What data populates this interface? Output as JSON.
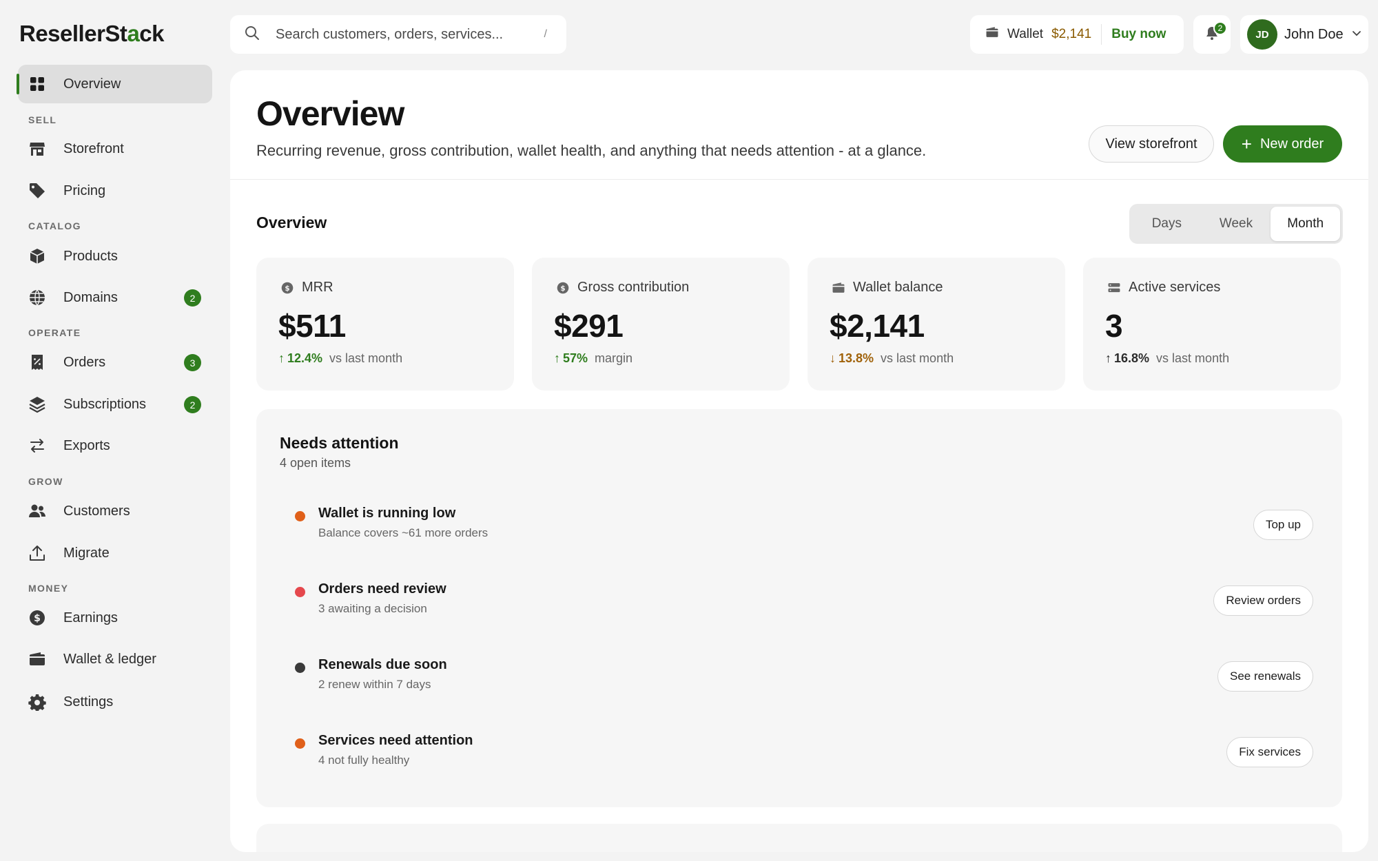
{
  "app": {
    "logo_text_1": "ResellerSt",
    "logo_text_2": "a",
    "logo_text_3": "ck"
  },
  "search": {
    "placeholder": "Search customers, orders, services...",
    "shortcut": "/"
  },
  "wallet": {
    "label": "Wallet",
    "amount": "$2,141",
    "buy_label": "Buy now"
  },
  "notifications": {
    "count": "2"
  },
  "user": {
    "initials": "JD",
    "name": "John Doe"
  },
  "sidebar": {
    "overview": "Overview",
    "sections": {
      "sell": "SELL",
      "catalog": "CATALOG",
      "operate": "OPERATE",
      "grow": "GROW",
      "money": "MONEY"
    },
    "items": {
      "storefront": "Storefront",
      "pricing": "Pricing",
      "products": "Products",
      "domains": "Domains",
      "domains_badge": "2",
      "orders": "Orders",
      "orders_badge": "3",
      "subscriptions": "Subscriptions",
      "subscriptions_badge": "2",
      "exports": "Exports",
      "customers": "Customers",
      "migrate": "Migrate",
      "earnings": "Earnings",
      "wallet_ledger": "Wallet & ledger",
      "settings": "Settings"
    }
  },
  "page": {
    "title": "Overview",
    "subtitle": "Recurring revenue, gross contribution, wallet health, and anything that needs attention - at a glance.",
    "view_storefront": "View storefront",
    "new_order": "New order"
  },
  "overview": {
    "title": "Overview",
    "periods": [
      "Days",
      "Week",
      "Month"
    ],
    "selected_period": "Month"
  },
  "kpis": [
    {
      "label": "MRR",
      "value": "$511",
      "delta": "12.4%",
      "direction": "up",
      "note": "vs last month"
    },
    {
      "label": "Gross contribution",
      "value": "$291",
      "delta": "57%",
      "direction": "up",
      "note": "margin"
    },
    {
      "label": "Wallet balance",
      "value": "$2,141",
      "delta": "13.8%",
      "direction": "down",
      "note": "vs last month"
    },
    {
      "label": "Active services",
      "value": "3",
      "delta": "16.8%",
      "direction": "up",
      "note": "vs last month"
    }
  ],
  "attention": {
    "title": "Needs attention",
    "subtitle": "4 open items",
    "items": [
      {
        "title": "Wallet is running low",
        "desc": "Balance covers ~61 more orders",
        "action": "Top up",
        "color": "#e0601a"
      },
      {
        "title": "Orders need review",
        "desc": "3 awaiting a decision",
        "action": "Review orders",
        "color": "#e5484d"
      },
      {
        "title": "Renewals due soon",
        "desc": "2 renew within 7 days",
        "action": "See renewals",
        "color": "#3a3a3a"
      },
      {
        "title": "Services need attention",
        "desc": "4 not fully healthy",
        "action": "Fix services",
        "color": "#e0601a"
      }
    ]
  },
  "colors": {
    "accent": "#2f7d1e",
    "warning": "#a0620a"
  }
}
